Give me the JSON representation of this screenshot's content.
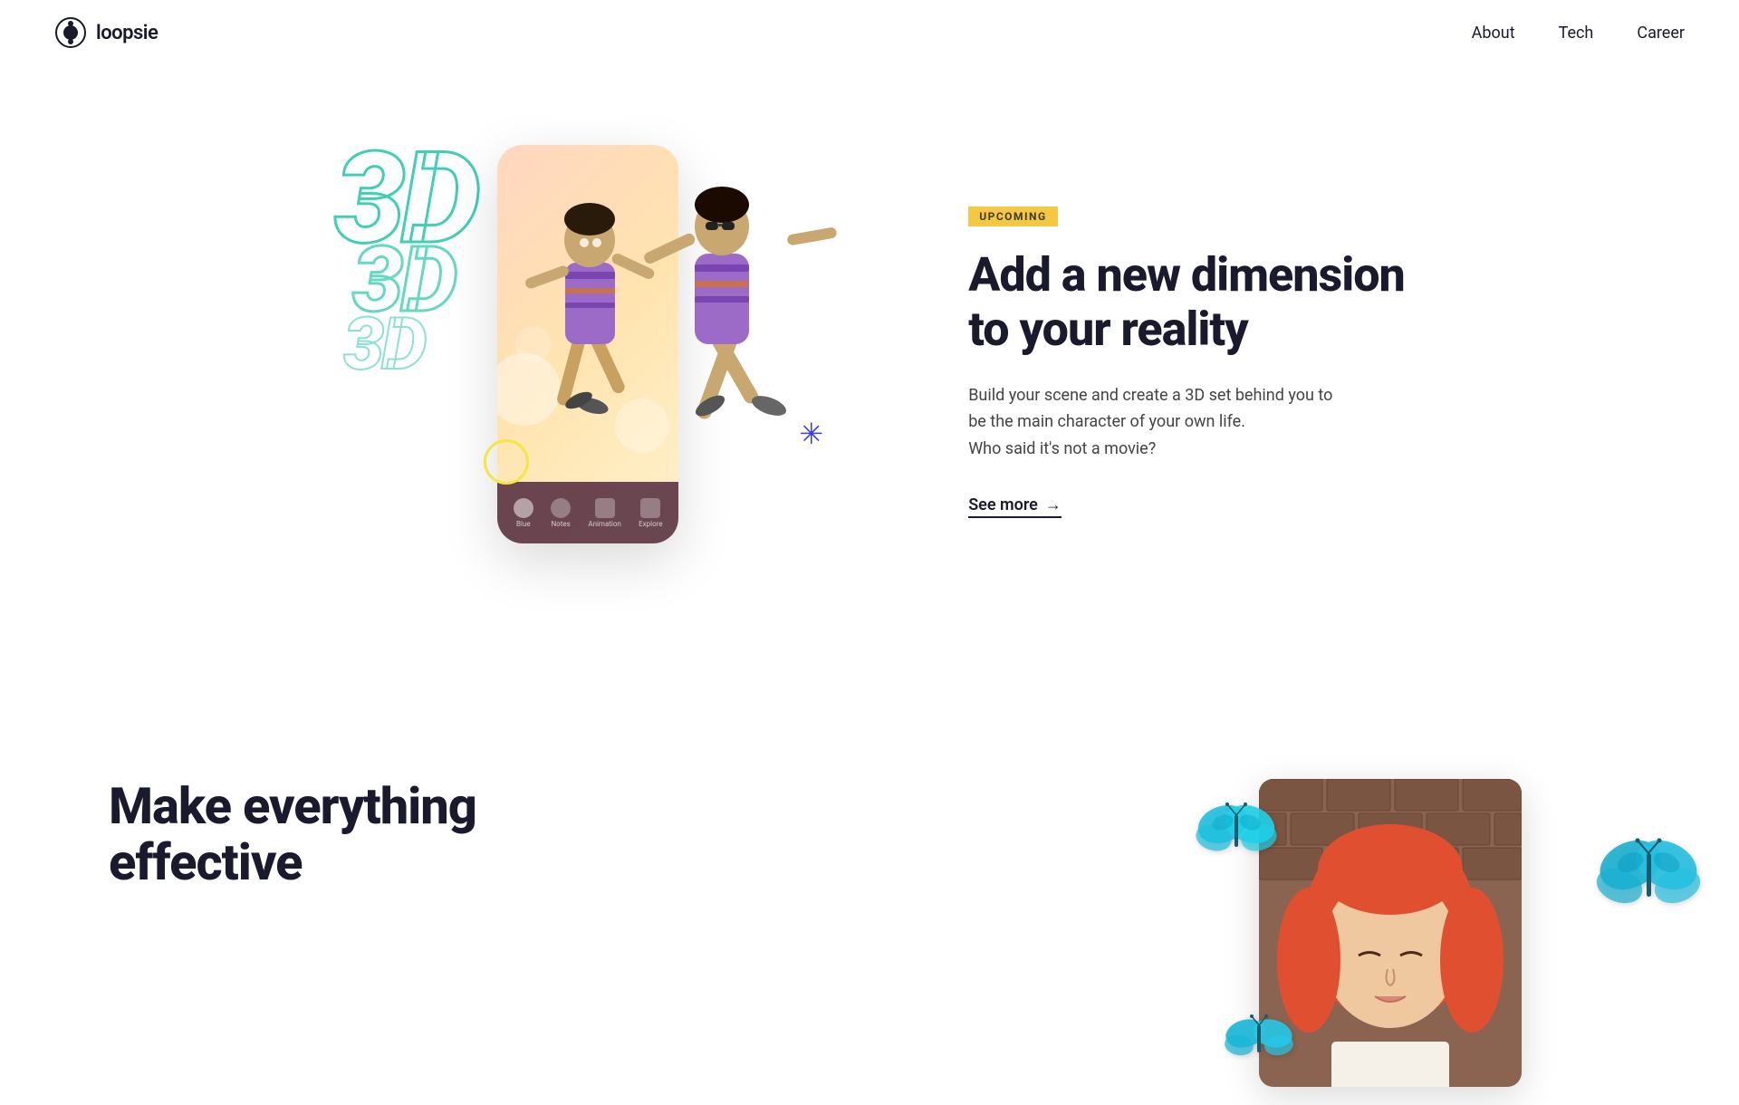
{
  "header": {
    "logo_text": "loopsie",
    "nav_items": [
      {
        "label": "About",
        "href": "#"
      },
      {
        "label": "Tech",
        "href": "#"
      },
      {
        "label": "Career",
        "href": "#"
      }
    ]
  },
  "section_3d": {
    "badge": "UPCOMING",
    "title_line1": "Add a new dimension",
    "title_line2": "to your reality",
    "description_line1": "Build your scene and create a 3D set behind you to",
    "description_line2": "be the main character of your own life.",
    "description_line3": "Who said it's not a movie?",
    "see_more_label": "See more",
    "arrow": "→"
  },
  "section_effective": {
    "title_line1": "Make everything",
    "title_line2": "effective"
  },
  "decorations": {
    "text_3d_1": "3D",
    "text_3d_2": "3D",
    "text_3d_3": "3D",
    "star_char": "✦",
    "asterisk_char": "✳"
  },
  "phone_tabs": [
    {
      "label": "Blue"
    },
    {
      "label": "Notes"
    },
    {
      "label": "Animation"
    },
    {
      "label": "Explore"
    }
  ]
}
